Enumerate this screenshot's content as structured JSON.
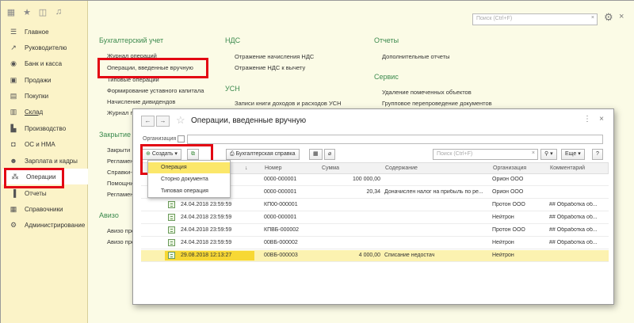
{
  "sidebar": {
    "toolbar_icons": [
      "grid-icon",
      "star-icon",
      "history-icon",
      "bell-icon"
    ],
    "items": [
      {
        "label": "Главное",
        "icon": "menu-icon"
      },
      {
        "label": "Руководителю",
        "icon": "trend-icon"
      },
      {
        "label": "Банк и касса",
        "icon": "bank-icon"
      },
      {
        "label": "Продажи",
        "icon": "cart-icon"
      },
      {
        "label": "Покупки",
        "icon": "basket-icon"
      },
      {
        "label": "Склад",
        "icon": "warehouse-icon"
      },
      {
        "label": "Производство",
        "icon": "factory-icon"
      },
      {
        "label": "ОС и НМА",
        "icon": "car-icon"
      },
      {
        "label": "Зарплата и кадры",
        "icon": "people-icon"
      },
      {
        "label": "Операции",
        "icon": "operations-icon"
      },
      {
        "label": "Отчеты",
        "icon": "chart-icon"
      },
      {
        "label": "Справочники",
        "icon": "book-icon"
      },
      {
        "label": "Администрирование",
        "icon": "gear-icon"
      }
    ]
  },
  "topbar": {
    "search_placeholder": "Поиск (Ctrl+F)"
  },
  "sections": {
    "accounting": {
      "title": "Бухгалтерский учет",
      "links": [
        "Журнал операций",
        "Операции, введенные вручную",
        "Типовые операции",
        "Формирование уставного капитала",
        "Начисление дивидендов",
        "Журнал п"
      ]
    },
    "closing": {
      "title": "Закрытие",
      "links": [
        "Закрыти",
        "Регламен",
        "Справки-р",
        "Помощни",
        "Регламен"
      ]
    },
    "aviso": {
      "title": "Авизо",
      "links": [
        "Авизо про",
        "Авизо про"
      ]
    },
    "vat": {
      "title": "НДС",
      "links": [
        "Отражение начисления НДС",
        "Отражение НДС к вычету"
      ]
    },
    "usn": {
      "title": "УСН",
      "links": [
        "Записи книги доходов и расходов УСН"
      ]
    },
    "reports": {
      "title": "Отчеты",
      "links": [
        "Дополнительные отчеты"
      ]
    },
    "service": {
      "title": "Сервис",
      "links": [
        "Удаление помеченных объектов",
        "Групповое перепроведение документов"
      ]
    }
  },
  "modal": {
    "title": "Операции, введенные вручную",
    "org_label": "Организация",
    "create_button": "Создать",
    "accounting_ref_button": "Бухгалтерская справка",
    "search_placeholder": "Поиск (Ctrl+F)",
    "more_button": "Еще",
    "help_button": "?",
    "dropdown": [
      "Операция",
      "Сторно документа",
      "Типовая операция"
    ],
    "columns": [
      "Номер",
      "Сумма",
      "Содержание",
      "Организация",
      "Комментарий"
    ],
    "rows": [
      {
        "date": "",
        "number": "0000-000001",
        "sum": "100 000,00",
        "content": "",
        "org": "Орион ООО",
        "comment": ""
      },
      {
        "date": "",
        "number": "0000-000001",
        "sum": "20,34",
        "content": "Доначислен налог на прибыль по ре...",
        "org": "Орион ООО",
        "comment": ""
      },
      {
        "date": "24.04.2018 23:59:59",
        "number": "КП00-000001",
        "sum": "",
        "content": "",
        "org": "Протон ООО",
        "comment": "## Обработка об..."
      },
      {
        "date": "24.04.2018 23:59:59",
        "number": "0000-000001",
        "sum": "",
        "content": "",
        "org": "Нейтрон",
        "comment": "## Обработка об..."
      },
      {
        "date": "24.04.2018 23:59:59",
        "number": "КПВБ-000002",
        "sum": "",
        "content": "",
        "org": "Протон ООО",
        "comment": "## Обработка об..."
      },
      {
        "date": "24.04.2018 23:59:59",
        "number": "00ВБ-000002",
        "sum": "",
        "content": "",
        "org": "Нейтрон",
        "comment": "## Обработка об..."
      },
      {
        "date": "29.08.2018 12:13:27",
        "number": "00ВБ-000003",
        "sum": "4 000,00",
        "content": "Списание недостач",
        "org": "Нейтрон",
        "comment": ""
      }
    ]
  },
  "colors": {
    "sidebar_bg": "#fbf3c8",
    "main_bg": "#fbfbe6",
    "section_title": "#3c8a4e",
    "highlight_frame": "#e30613",
    "selection": "#f7d834"
  }
}
